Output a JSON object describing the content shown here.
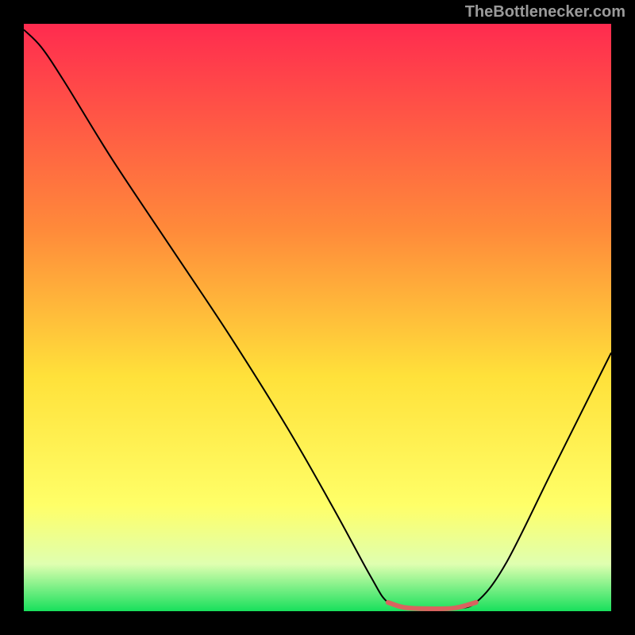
{
  "watermark": "TheBottleneсker.com",
  "chart_data": {
    "type": "line",
    "title": "",
    "xlabel": "",
    "ylabel": "",
    "xlim": [
      0,
      100
    ],
    "ylim": [
      0,
      100
    ],
    "gradient_stops": [
      {
        "offset": 0,
        "color": "#ff2b4f"
      },
      {
        "offset": 35,
        "color": "#ff8a3a"
      },
      {
        "offset": 60,
        "color": "#ffe13a"
      },
      {
        "offset": 82,
        "color": "#ffff68"
      },
      {
        "offset": 92,
        "color": "#dfffb0"
      },
      {
        "offset": 100,
        "color": "#18e05c"
      }
    ],
    "series": [
      {
        "name": "bottleneck-curve",
        "color": "#000000",
        "points": [
          {
            "x": 0,
            "y": 99
          },
          {
            "x": 3,
            "y": 96
          },
          {
            "x": 7,
            "y": 90
          },
          {
            "x": 15,
            "y": 77
          },
          {
            "x": 25,
            "y": 62
          },
          {
            "x": 35,
            "y": 47
          },
          {
            "x": 45,
            "y": 31
          },
          {
            "x": 53,
            "y": 17
          },
          {
            "x": 59,
            "y": 6
          },
          {
            "x": 62,
            "y": 1.5
          },
          {
            "x": 66,
            "y": 0.5
          },
          {
            "x": 73,
            "y": 0.5
          },
          {
            "x": 77,
            "y": 1.5
          },
          {
            "x": 82,
            "y": 8
          },
          {
            "x": 90,
            "y": 24
          },
          {
            "x": 100,
            "y": 44
          }
        ]
      },
      {
        "name": "optimal-highlight",
        "color": "#d9635f",
        "stroke_width": 6,
        "points": [
          {
            "x": 62,
            "y": 1.5
          },
          {
            "x": 64,
            "y": 0.8
          },
          {
            "x": 66,
            "y": 0.5
          },
          {
            "x": 70,
            "y": 0.4
          },
          {
            "x": 73,
            "y": 0.5
          },
          {
            "x": 75,
            "y": 0.9
          },
          {
            "x": 77,
            "y": 1.5
          }
        ]
      }
    ]
  }
}
